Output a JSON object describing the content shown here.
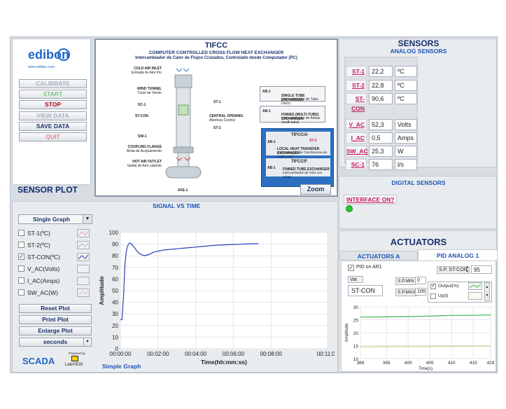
{
  "logo": {
    "brand": "edibon",
    "url": "www.edibon.com"
  },
  "controls": {
    "calibrate": "CALIBRATE",
    "start": "START",
    "stop": "STOP",
    "view_data": "VIEW DATA",
    "save_data": "SAVE DATA",
    "quit": "QUIT"
  },
  "diagram": {
    "title": "TIFCC",
    "subtitle": "COMPUTER CONTROLLED CROSS FLOW HEAT EXCHANGER",
    "subtitle_es": "Intercambiador de Calor de Flujos Cruzados, Controlado desde Computador (PC)",
    "cold_air": "COLD AIR INLET",
    "cold_air_es": "Entrada de Aire frío",
    "wind_tunnel": "WIND TUNNEL",
    "wind_tunnel_es": "Túnel de Viento",
    "sc1": "SC-1",
    "stcon": "ST-CON",
    "sw1": "SW-1",
    "st1": "ST-1",
    "st2": "ST-2",
    "st3": "ST-3",
    "central_opening": "CENTRAL OPENING",
    "central_opening_es": "Abertura Central",
    "coupling": "COUPLING FLANGE",
    "coupling_es": "Brida de Acoplamiento",
    "hot_air": "HOT AIR OUTLET",
    "hot_air_es": "Salida de Aire caliente",
    "ave1": "AVE-1",
    "ab1": "AB-1",
    "single_tube": "SINGLE TUBE EXCHANGER",
    "single_tube_es": "Intercambiador de Tubo Único",
    "finned": "FINNED (MULTI-TUBE) EXCHANGER",
    "finned_es": "Intercambiador de Aletas (multi-tubo)",
    "tifcca": "TIFCC/A",
    "local_heat": "LOCAL HEAT TRANSFER EXCHANGER",
    "local_heat_es": "Intercambiador de Transferencia de Calor Local",
    "tifccf": "TIFCC/F",
    "finned_tube": "FINNED TUBE EXCHANGER",
    "finned_tube_es": "Intercambiador de Tubo con Aletas",
    "zoom": "Zoom"
  },
  "sensors": {
    "title": "SENSORS",
    "analog": "ANALOG SENSORS",
    "rows": [
      {
        "label": "ST-1",
        "value": "22,2",
        "unit": "ºC"
      },
      {
        "label": "ST-2",
        "value": "22,8",
        "unit": "ºC"
      },
      {
        "label": "ST-CON",
        "value": "90,6",
        "unit": "ºC"
      },
      {
        "label": "V_AC",
        "value": "52,3",
        "unit": "Volts"
      },
      {
        "label": "I_AC",
        "value": "0,5",
        "unit": "Amps"
      },
      {
        "label": "SW_AC",
        "value": "25,3",
        "unit": "W"
      },
      {
        "label": "SC-1",
        "value": "76",
        "unit": "l/s"
      }
    ],
    "digital": "DIGITAL SENSORS",
    "interface": "INTERFACE ON?",
    "interface_color": "#29c629"
  },
  "sensor_plot": {
    "title": "SENSOR PLOT",
    "signal_title": "SIGNAL VS TIME",
    "mode": "Single Graph",
    "legend": [
      {
        "label": "ST-1(ºC)",
        "checked": "",
        "color": "#d9a0b5"
      },
      {
        "label": "ST-2(ºC)",
        "checked": "",
        "color": "#aab0e0"
      },
      {
        "label": "ST-CON(ºC)",
        "checked": "✓",
        "color": "#2a3fb4"
      },
      {
        "label": "V_AC(Volts)",
        "checked": "",
        "color": "#c8d6c8"
      },
      {
        "label": "I_AC(Amps)",
        "checked": "",
        "color": "#e7d6a0"
      },
      {
        "label": "SW_AC(W)",
        "checked": "",
        "color": "#e4b8cf"
      }
    ],
    "reset": "Reset Plot",
    "print": "Print Plot",
    "enlarge": "Enlarge Plot",
    "units": "seconds",
    "graph_footer": "Simple Graph"
  },
  "chart_data": [
    {
      "type": "line",
      "ylabel": "Amplitude",
      "xlabel": "Time(hh:mm:ss)",
      "ylim": [
        0,
        100
      ],
      "yticks": [
        "0",
        "10",
        "20",
        "30",
        "40",
        "50",
        "60",
        "70",
        "80",
        "90",
        "100"
      ],
      "xticks": [
        "00:00:00",
        "00:02:00",
        "00:04:00",
        "00:06:00",
        "00:08:00",
        "00:11:00"
      ],
      "series": [
        {
          "name": "ST-CON(ºC)",
          "color": "#2a3fb4",
          "x": [
            0,
            5,
            10,
            14,
            18,
            22,
            26,
            30,
            36,
            42,
            50,
            60,
            75,
            90,
            105,
            120,
            140,
            160,
            180,
            200,
            220,
            240,
            260,
            280,
            300,
            320,
            340,
            360,
            380,
            400,
            420,
            440
          ],
          "y": [
            25,
            25,
            45,
            70,
            82,
            88,
            90,
            91,
            90,
            88,
            85,
            82,
            80,
            81,
            83,
            84,
            85,
            85.5,
            86,
            86.5,
            87,
            87.5,
            88,
            88.5,
            89,
            89.2,
            89.5,
            89.7,
            89.9,
            90.1,
            90.3,
            90.5
          ]
        }
      ]
    },
    {
      "type": "line",
      "ylabel": "Amplitude",
      "xlabel": "Time(s)",
      "xlim": [
        389,
        419
      ],
      "ylim": [
        10,
        30
      ],
      "xticks": [
        "389",
        "395",
        "400",
        "405",
        "410",
        "415",
        "419"
      ],
      "yticks": [
        "10",
        "15",
        "20",
        "25",
        "30"
      ],
      "series": [
        {
          "name": "Output(%)",
          "color": "#39b54a",
          "x": [
            389,
            400,
            405,
            408,
            419
          ],
          "y": [
            26,
            26.2,
            26.4,
            26.6,
            26.8
          ]
        },
        {
          "name": "Up(t)",
          "color": "#cfcf8a",
          "x": [
            389,
            419
          ],
          "y": [
            14.5,
            14.8
          ]
        }
      ]
    }
  ],
  "actuators": {
    "title": "ACTUATORS",
    "tab_a": "ACTUATORS A",
    "tab_pid": "PID ANALOG 1",
    "pid_on": "PID on AR1",
    "var_label": "Var.",
    "var_value": "ST-CON",
    "sp_label": "S.P. ST-CON",
    "sp_value": "95",
    "sp_min_label": "S.P.MIN",
    "sp_min": "0",
    "sp_max_label": "S.P.MAX",
    "sp_max": "100",
    "output_label": "Output(%)",
    "up_label": "Up(t)"
  },
  "footer": {
    "scada": "SCADA",
    "powered": "Powered by",
    "labview": "LabVIEW"
  }
}
